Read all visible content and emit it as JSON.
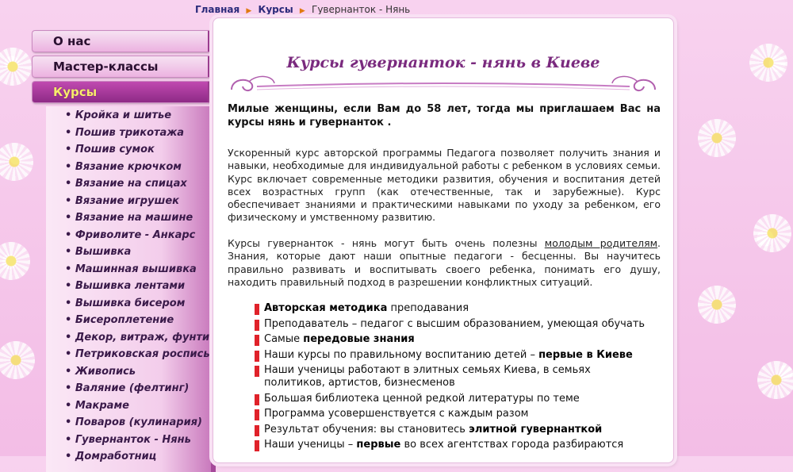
{
  "breadcrumb": {
    "home": "Главная",
    "section": "Курсы",
    "current": "Гувернанток - Нянь"
  },
  "menu": {
    "tabs": [
      "О нас",
      "Мастер-классы",
      "Курсы"
    ],
    "items": [
      "• Кройка и шитье",
      "• Пошив трикотажа",
      "• Пошив сумок",
      "• Вязание крючком",
      "• Вязание на спицах",
      "• Вязание игрушек",
      "• Вязание на машине",
      "• Фриволите - Анкарс",
      "• Вышивка",
      "• Машинная вышивка",
      "• Вышивка лентами",
      "• Вышивка бисером",
      "• Бисероплетение",
      "• Декор, витраж, фунтик",
      "• Петриковская роспись",
      "• Живопись",
      "• Валяние (фелтинг)",
      "• Макраме",
      "• Поваров (кулинария)",
      "• Гувернанток - Нянь",
      "• Домработниц"
    ]
  },
  "content": {
    "title": "Курсы гувернанток - нянь в Киеве",
    "lead": "Милые женщины, если Вам до 58 лет, тогда мы приглашаем Вас на курсы нянь и гувернанток .",
    "para1": "Ускоренный курс авторской программы  Педагога позволяет получить знания и навыки, необходимые для индивидуальной работы с ребенком в условиях семьи. Курс включает современные методики развития, обучения и воспитания детей всех возрастных групп (как отечественные, так и зарубежные). Курс обеспечивает знаниями и практическими навыками по уходу за ребенком, его физическому и умственному развитию.",
    "para2_before": "Курсы гувернанток - нянь могут быть очень полезны ",
    "para2_link": "молодым родителям",
    "para2_after": ". Знания, которые дают наши опытные педагоги - бесценны. Вы научитесь правильно развивать и воспитывать своего ребенка, понимать его душу, находить правильный подход в разрешении конфликтных ситуаций.",
    "list": [
      {
        "pre": "",
        "bold": "Авторская методика",
        "post": " преподавания"
      },
      {
        "pre": "Преподаватель – педагог с высшим образованием, умеющая обучать",
        "bold": "",
        "post": ""
      },
      {
        "pre": "Самые ",
        "bold": "передовые знания",
        "post": ""
      },
      {
        "pre": "Наши курсы по правильному воспитанию детей – ",
        "bold": "первые в Киеве",
        "post": ""
      },
      {
        "pre": "Наши ученицы работают в элитных семьях Киева, в семьях политиков, артистов, бизнесменов",
        "bold": "",
        "post": ""
      },
      {
        "pre": "Большая библиотека ценной редкой литературы по теме",
        "bold": "",
        "post": ""
      },
      {
        "pre": "Программа усовершенствуется с каждым разом",
        "bold": "",
        "post": ""
      },
      {
        "pre": "Результат обучения: вы становитесь ",
        "bold": "элитной гувернанткой",
        "post": ""
      },
      {
        "pre": "Наши ученицы – ",
        "bold": "первые",
        "post": " во всех агентствах города разбираются "
      }
    ]
  }
}
